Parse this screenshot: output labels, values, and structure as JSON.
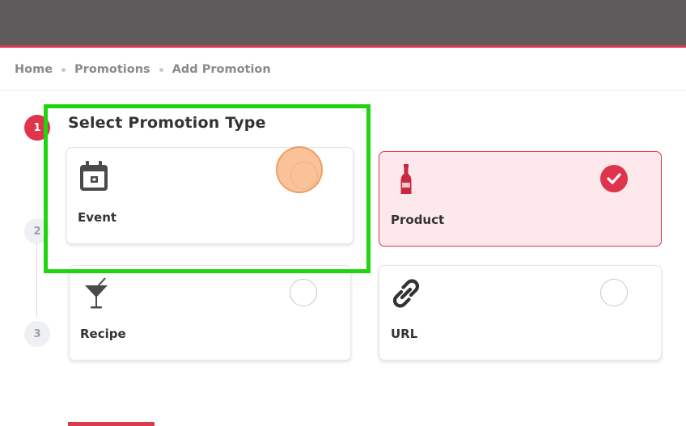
{
  "breadcrumb": {
    "items": [
      "Home",
      "Promotions",
      "Add Promotion"
    ]
  },
  "steps": [
    {
      "number": "1",
      "state": "active"
    },
    {
      "number": "2",
      "state": "idle"
    },
    {
      "number": "3",
      "state": "idle"
    }
  ],
  "section": {
    "title": "Select Promotion Type"
  },
  "promotion_types": {
    "event": {
      "label": "Event",
      "icon": "calendar-icon",
      "selected": false
    },
    "product": {
      "label": "Product",
      "icon": "wine-bottle-icon",
      "selected": true
    },
    "recipe": {
      "label": "Recipe",
      "icon": "cocktail-glass-icon",
      "selected": false
    },
    "url": {
      "label": "URL",
      "icon": "link-icon",
      "selected": false
    }
  },
  "colors": {
    "accent": "#e0344d",
    "topbar": "#5f5a5b",
    "selected_card_bg": "#fde9ec",
    "highlight": "#1fd60e",
    "click_marker": "#f7ad76"
  }
}
